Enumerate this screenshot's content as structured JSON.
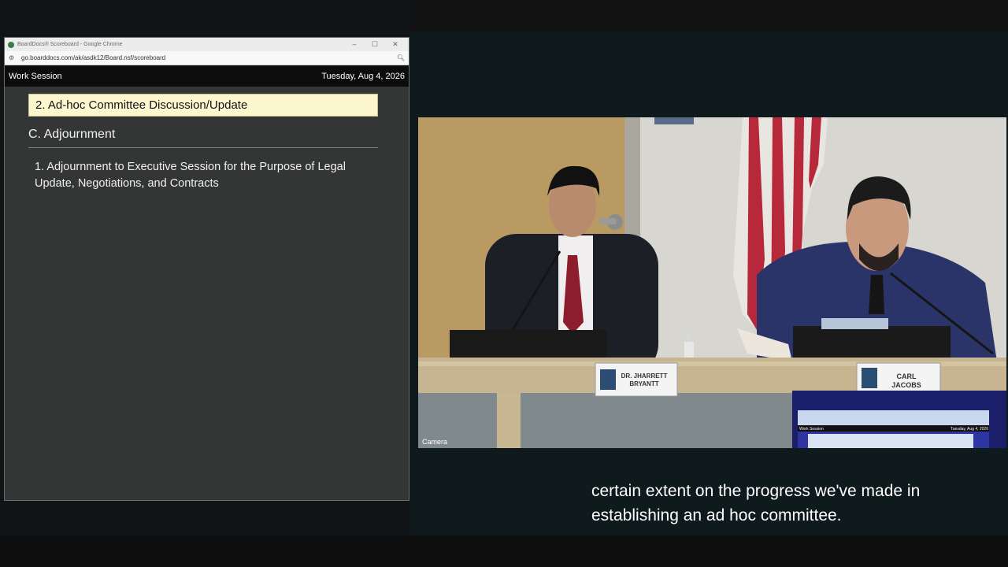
{
  "browser": {
    "window_title": "BoardDocs® Scoreboard - Google Chrome",
    "url": "go.boarddocs.com/ak/asdk12/Board.nsf/scoreboard",
    "controls": {
      "minimize": "–",
      "maximize": "☐",
      "close": "✕"
    }
  },
  "session": {
    "name": "Work Session",
    "date": "Tuesday, Aug 4, 2026"
  },
  "agenda": {
    "current_item": "2. Ad-hoc Committee Discussion/Update",
    "section_heading": "C. Adjournment",
    "items": [
      "1. Adjournment to Executive Session for the Purpose of Legal Update, Negotiations, and Contracts"
    ]
  },
  "video": {
    "camera_label": "Camera",
    "nameplates": [
      {
        "line1": "DR. JHARRETT",
        "line2": "BRYANTT"
      },
      {
        "line1": "CARL",
        "line2": "JACOBS"
      }
    ],
    "monitor": {
      "left_text": "Work Session",
      "right_text": "Tuesday, Aug 4, 2026"
    }
  },
  "caption": {
    "lines": [
      "certain extent on the progress we've made in",
      "establishing an ad hoc committee."
    ]
  },
  "colors": {
    "current_item_bg": "#fdf7d0",
    "header_bg": "#0c0c0c",
    "panel_bg": "#333634"
  }
}
